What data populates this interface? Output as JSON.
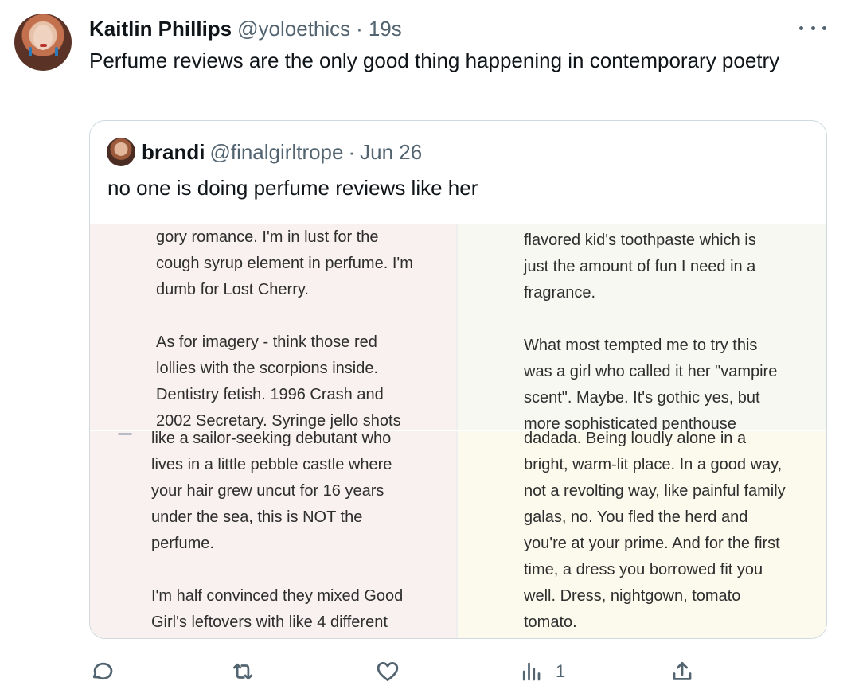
{
  "tweet": {
    "author_name": "Kaitlin Phillips",
    "author_handle": "@yoloethics",
    "separator": "·",
    "time": "19s",
    "text": "Perfume reviews are the only good thing happening in contemporary poetry"
  },
  "quoted": {
    "author_name": "brandi",
    "author_handle": "@finalgirltrope",
    "separator": "·",
    "date": "Jun 26",
    "text": "no one is doing perfume reviews like her",
    "images": {
      "top_left": [
        "gory romance. I'm in lust for the",
        "cough syrup element in perfume. I'm",
        "dumb for Lost Cherry.",
        "",
        "As for imagery - think those red",
        "lollies with the scorpions inside.",
        "Dentistry fetish. 1996 Crash and",
        "2002 Secretary. Syringe jello shots"
      ],
      "top_right": [
        "flavored kid's toothpaste which is",
        "just the amount of fun I need in a",
        "fragrance.",
        "",
        "What most tempted me to try this",
        "was a girl who called it her \"vampire",
        "scent\". Maybe. It's gothic yes, but",
        "more sophisticated penthouse"
      ],
      "bottom_left": [
        "like a sailor-seeking debutant who",
        "lives in a little pebble castle where",
        "your hair grew uncut for 16 years",
        "under the sea, this is NOT the",
        "perfume.",
        "",
        "I'm half convinced they mixed Good",
        "Girl's leftovers with like 4 different"
      ],
      "bottom_right": [
        "dadada. Being loudly alone in a",
        "bright, warm-lit place. In a good way,",
        "not a revolting way, like painful family",
        "galas, no. You fled the herd and",
        "you're at your prime. And for the first",
        "time, a dress you borrowed fit you",
        "well. Dress, nightgown, tomato",
        "tomato."
      ]
    }
  },
  "actions": {
    "reply_icon": "reply-icon",
    "retweet_icon": "retweet-icon",
    "like_icon": "heart-icon",
    "views_icon": "views-icon",
    "views_count": "1",
    "share_icon": "share-icon"
  },
  "colors": {
    "text": "#0f1419",
    "secondary": "#536471",
    "border": "#cfd9de"
  }
}
